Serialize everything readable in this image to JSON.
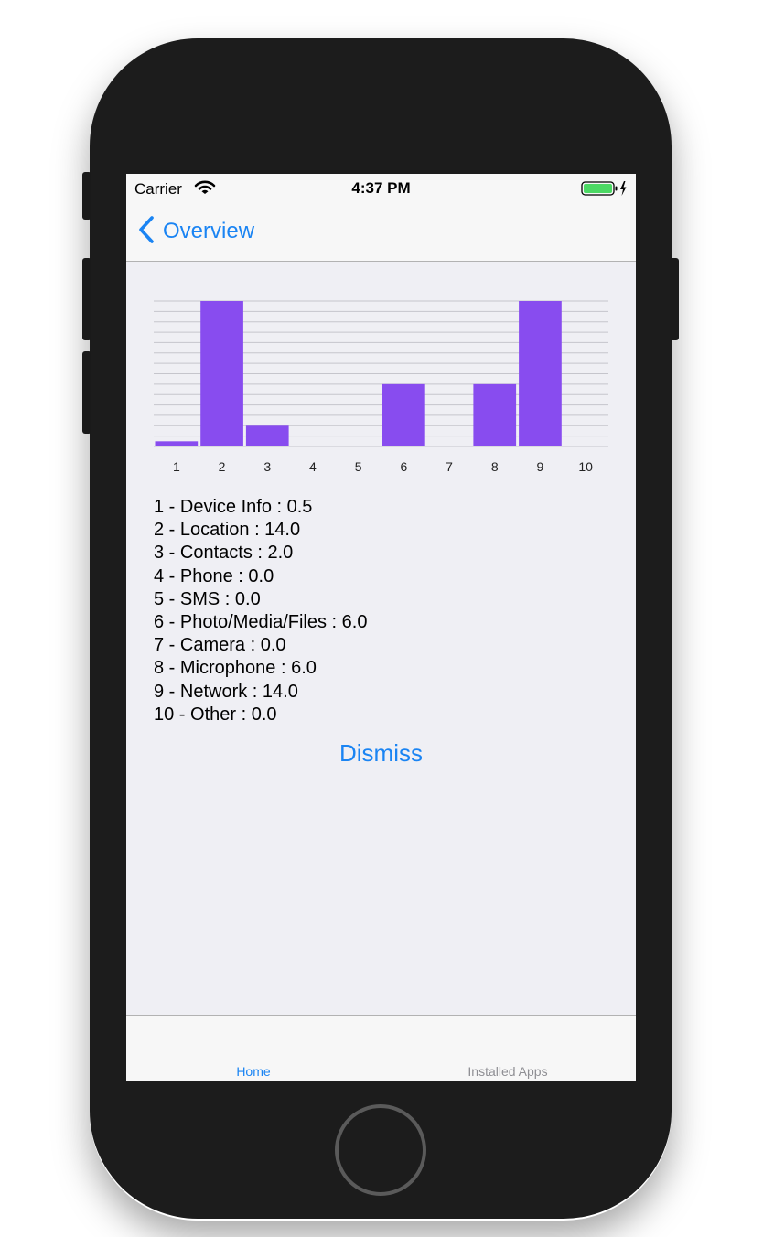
{
  "status_bar": {
    "carrier": "Carrier",
    "time": "4:37 PM"
  },
  "nav": {
    "back_label": "Overview"
  },
  "chart_data": {
    "type": "bar",
    "categories": [
      "1",
      "2",
      "3",
      "4",
      "5",
      "6",
      "7",
      "8",
      "9",
      "10"
    ],
    "values": [
      0.5,
      14.0,
      2.0,
      0.0,
      0.0,
      6.0,
      0.0,
      6.0,
      14.0,
      0.0
    ],
    "ylim": [
      0,
      14
    ],
    "grid": true,
    "bar_color": "#884cef"
  },
  "legend": {
    "items": [
      "1 - Device Info : 0.5",
      "2 - Location : 14.0",
      "3 - Contacts : 2.0",
      "4 - Phone : 0.0",
      "5 - SMS : 0.0",
      "6 - Photo/Media/Files : 6.0",
      "7 - Camera : 0.0",
      "8 - Microphone : 6.0",
      "9 - Network : 14.0",
      "10 - Other : 0.0"
    ]
  },
  "dismiss_label": "Dismiss",
  "tabs": [
    {
      "label": "Home",
      "active": true
    },
    {
      "label": "Installed Apps",
      "active": false
    }
  ],
  "colors": {
    "accent": "#1a84f3",
    "bar": "#884cef",
    "background": "#efeff4"
  }
}
